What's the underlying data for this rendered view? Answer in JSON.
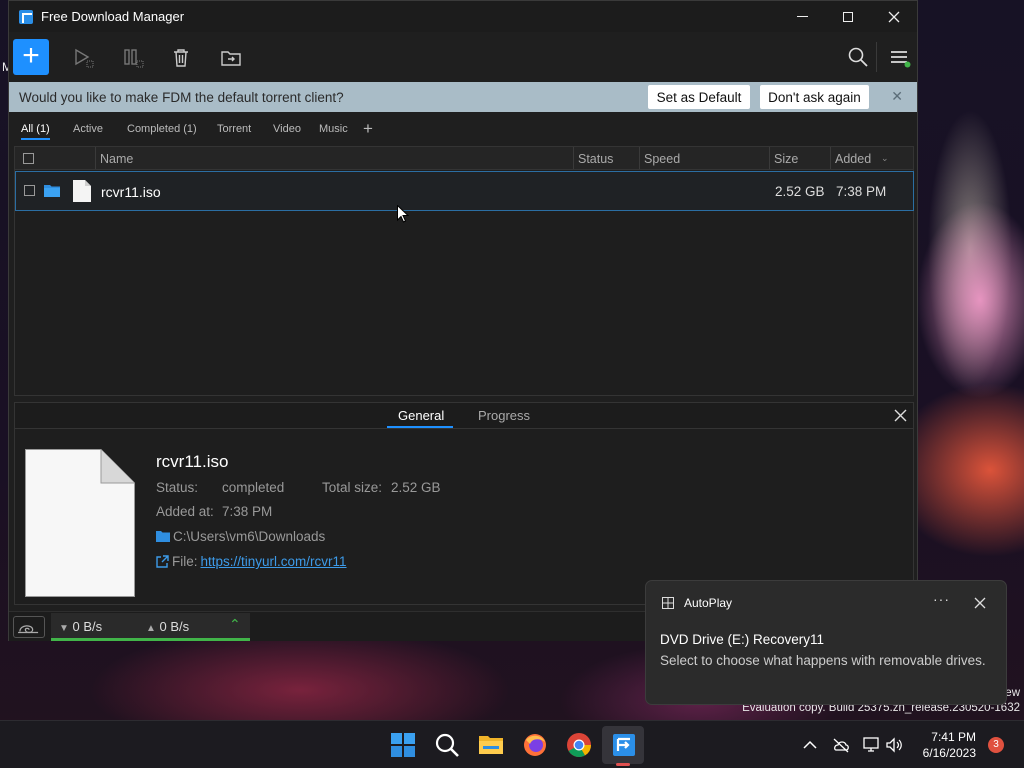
{
  "window": {
    "title": "Free Download Manager",
    "add_label": "+"
  },
  "torrent_prompt": {
    "message": "Would you like to make FDM the default torrent client?",
    "set_default": "Set as Default",
    "dont_ask": "Don't ask again",
    "close": "✕"
  },
  "filters": {
    "all": "All (1)",
    "active": "Active",
    "completed": "Completed (1)",
    "torrent": "Torrent",
    "video": "Video",
    "music": "Music",
    "add": "+"
  },
  "columns": {
    "name": "Name",
    "status": "Status",
    "speed": "Speed",
    "size": "Size",
    "added": "Added"
  },
  "downloads": [
    {
      "name": "rcvr11.iso",
      "status": "",
      "speed": "",
      "size": "2.52 GB",
      "added": "7:38 PM"
    }
  ],
  "details": {
    "tab_general": "General",
    "tab_progress": "Progress",
    "file_name": "rcvr11.iso",
    "status_label": "Status:",
    "status_value": "completed",
    "total_label": "Total size:",
    "total_value": "2.52 GB",
    "added_label": "Added at:",
    "added_value": "7:38 PM",
    "path": "C:\\Users\\vm6\\Downloads",
    "file_label": "File:",
    "file_link": "https://tinyurl.com/rcvr11"
  },
  "statusbar": {
    "download_speed": "0 B/s",
    "upload_speed": "0 B/s"
  },
  "toast": {
    "app": "AutoPlay",
    "more": "···",
    "title": "DVD Drive (E:) Recovery11",
    "body": "Select to choose what happens with removable drives."
  },
  "desktop": {
    "edition_fragment": "ew",
    "build": "Evaluation copy. Build 25375.zn_release.230520-1632",
    "left_fragment": "M"
  },
  "taskbar": {
    "time": "7:41 PM",
    "date": "6/16/2023",
    "notifications": "3"
  },
  "colors": {
    "accent": "#1e90ff",
    "prompt_bar": "#a9bcc7",
    "speed_ok": "#41b549",
    "badge": "#e0513f"
  }
}
